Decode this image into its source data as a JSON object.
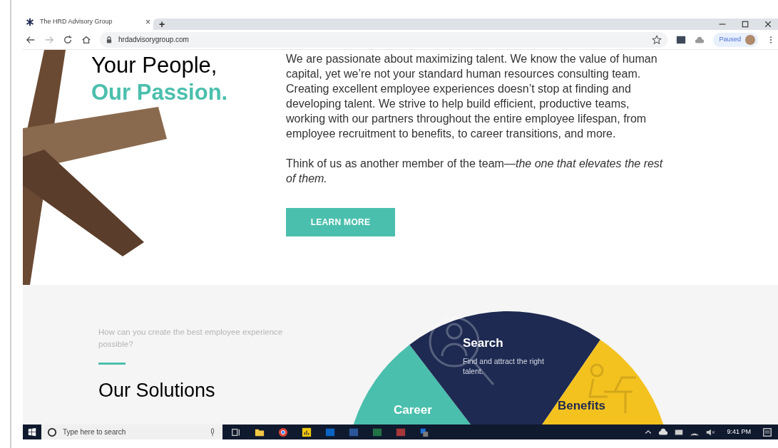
{
  "browser": {
    "tab": {
      "title": "The HRD Advisory Group",
      "close": "×",
      "new_tab": "+"
    },
    "url": "hrdadvisorygroup.com",
    "profile": "Paused"
  },
  "hero": {
    "heading_line1": "Your People,",
    "heading_line2": "Our Passion.",
    "paragraphs": [
      "We are passionate about maximizing talent. We know the value of human capital, yet we’re not your standard human resources consulting team. Creating excellent employee experiences doesn’t stop at finding and developing talent. We strive to help build efficient, productive teams, working with our partners throughout the entire employee lifespan, from employee recruitment to benefits, to career transitions, and more.",
      "Think of us as another member of the team—*the one that elevates the rest of them.*"
    ],
    "button": "LEARN MORE"
  },
  "solutions": {
    "eyebrow": "How can you create the best employee experience possible?",
    "heading": "Our Solutions",
    "segments": [
      {
        "title": "Career",
        "color": "#4bbfad"
      },
      {
        "title": "Search",
        "description": "Find and attract the right talent.",
        "color": "#1e2a52"
      },
      {
        "title": "Benefits",
        "color": "#f4c21f"
      }
    ]
  },
  "taskbar": {
    "search_placeholder": "Type here to search",
    "time": "9:41 PM"
  }
}
